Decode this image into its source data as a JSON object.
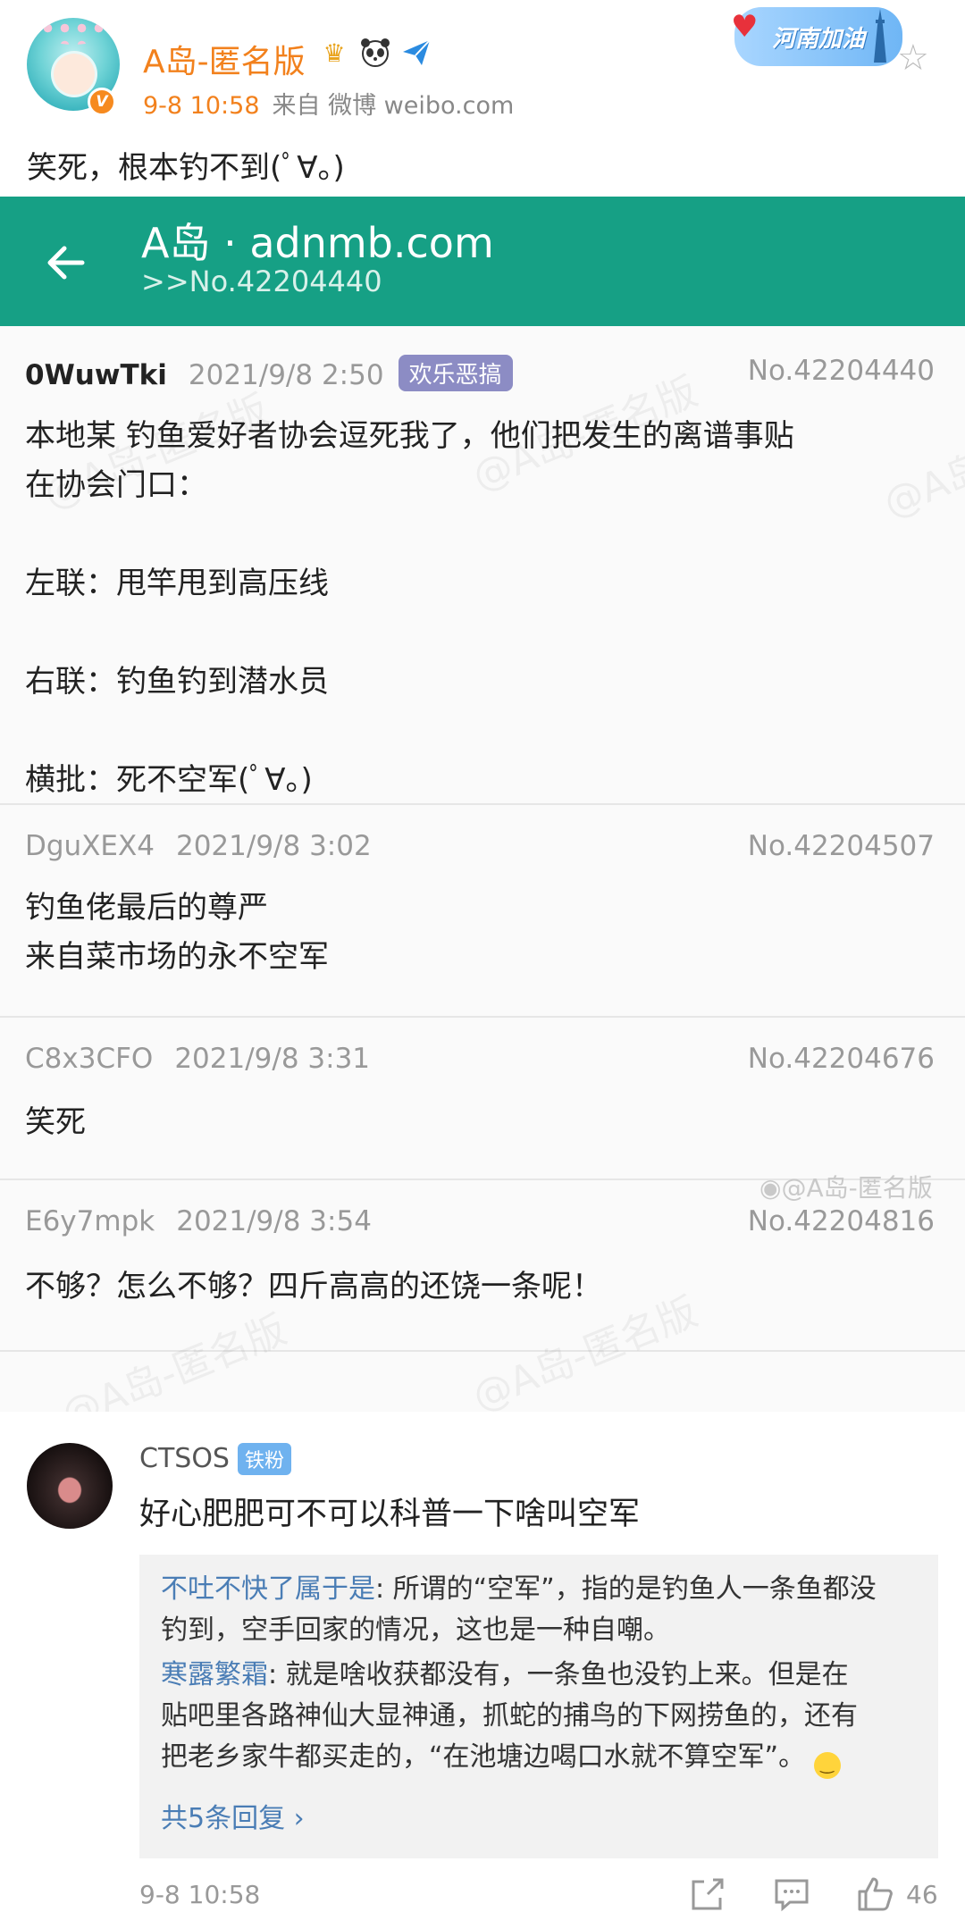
{
  "post": {
    "username": "A岛-匿名版",
    "time": "9-8 10:58",
    "source": "来自 微博 weibo.com",
    "text": "笑死，根本钓不到(ﾟ∀。)",
    "badge": "河南加油",
    "icons": [
      "crown-icon",
      "panda-icon",
      "paper-plane-icon",
      "verified-badge-icon",
      "star-icon"
    ]
  },
  "screenshot": {
    "appbar": {
      "title": "A岛 · adnmb.com",
      "subtitle": ">>No.42204440",
      "color": "#16a085"
    },
    "replies": [
      {
        "uid": "0WuwTki",
        "date": "2021/9/8 2:50",
        "tag": "欢乐恶搞",
        "no": "No.42204440",
        "lines": [
          "本地某 钓鱼爱好者协会逗死我了，他们把发生的离谱事贴",
          "在协会门口：",
          "",
          "左联：甩竿甩到高压线",
          "",
          "右联：钓鱼钓到潜水员",
          "",
          "横批：死不空军(ﾟ∀。)"
        ]
      },
      {
        "uid": "DguXEX4",
        "date": "2021/9/8 3:02",
        "no": "No.42204507",
        "lines": [
          "钓鱼佬最后的尊严",
          "来自菜市场的永不空军"
        ]
      },
      {
        "uid": "C8x3CFO",
        "date": "2021/9/8 3:31",
        "no": "No.42204676",
        "lines": [
          "笑死"
        ]
      },
      {
        "uid": "E6y7mpk",
        "date": "2021/9/8 3:54",
        "no": "No.42204816",
        "lines": [
          "不够？怎么不够？四斤高高的还饶一条呢！"
        ]
      }
    ],
    "watermark": "@A岛-匿名版",
    "weibo_watermark": "@A岛-匿名版"
  },
  "comment": {
    "user": "CTSOS",
    "badge": "铁粉",
    "text": "好心肥肥可不可以科普一下啥叫空军",
    "sub_replies": [
      {
        "name": "不吐不快了属于是",
        "lines": [
          ": 所谓的“空军”，指的是钓鱼人一条鱼都没",
          "钓到，空手回家的情况，这也是一种自嘲。"
        ]
      },
      {
        "name": "寒露繁霜",
        "lines": [
          ": 就是啥收获都没有，一条鱼也没钓上来。但是在",
          "贴吧里各路神仙大显神通，抓蛇的捕鸟的下网捞鱼的，还有",
          "把老乡家牛都买走的，“在池塘边喝口水就不算空军”。"
        ]
      }
    ],
    "more": "共5条回复 ›",
    "time": "9-8 10:58",
    "likes": "46"
  }
}
